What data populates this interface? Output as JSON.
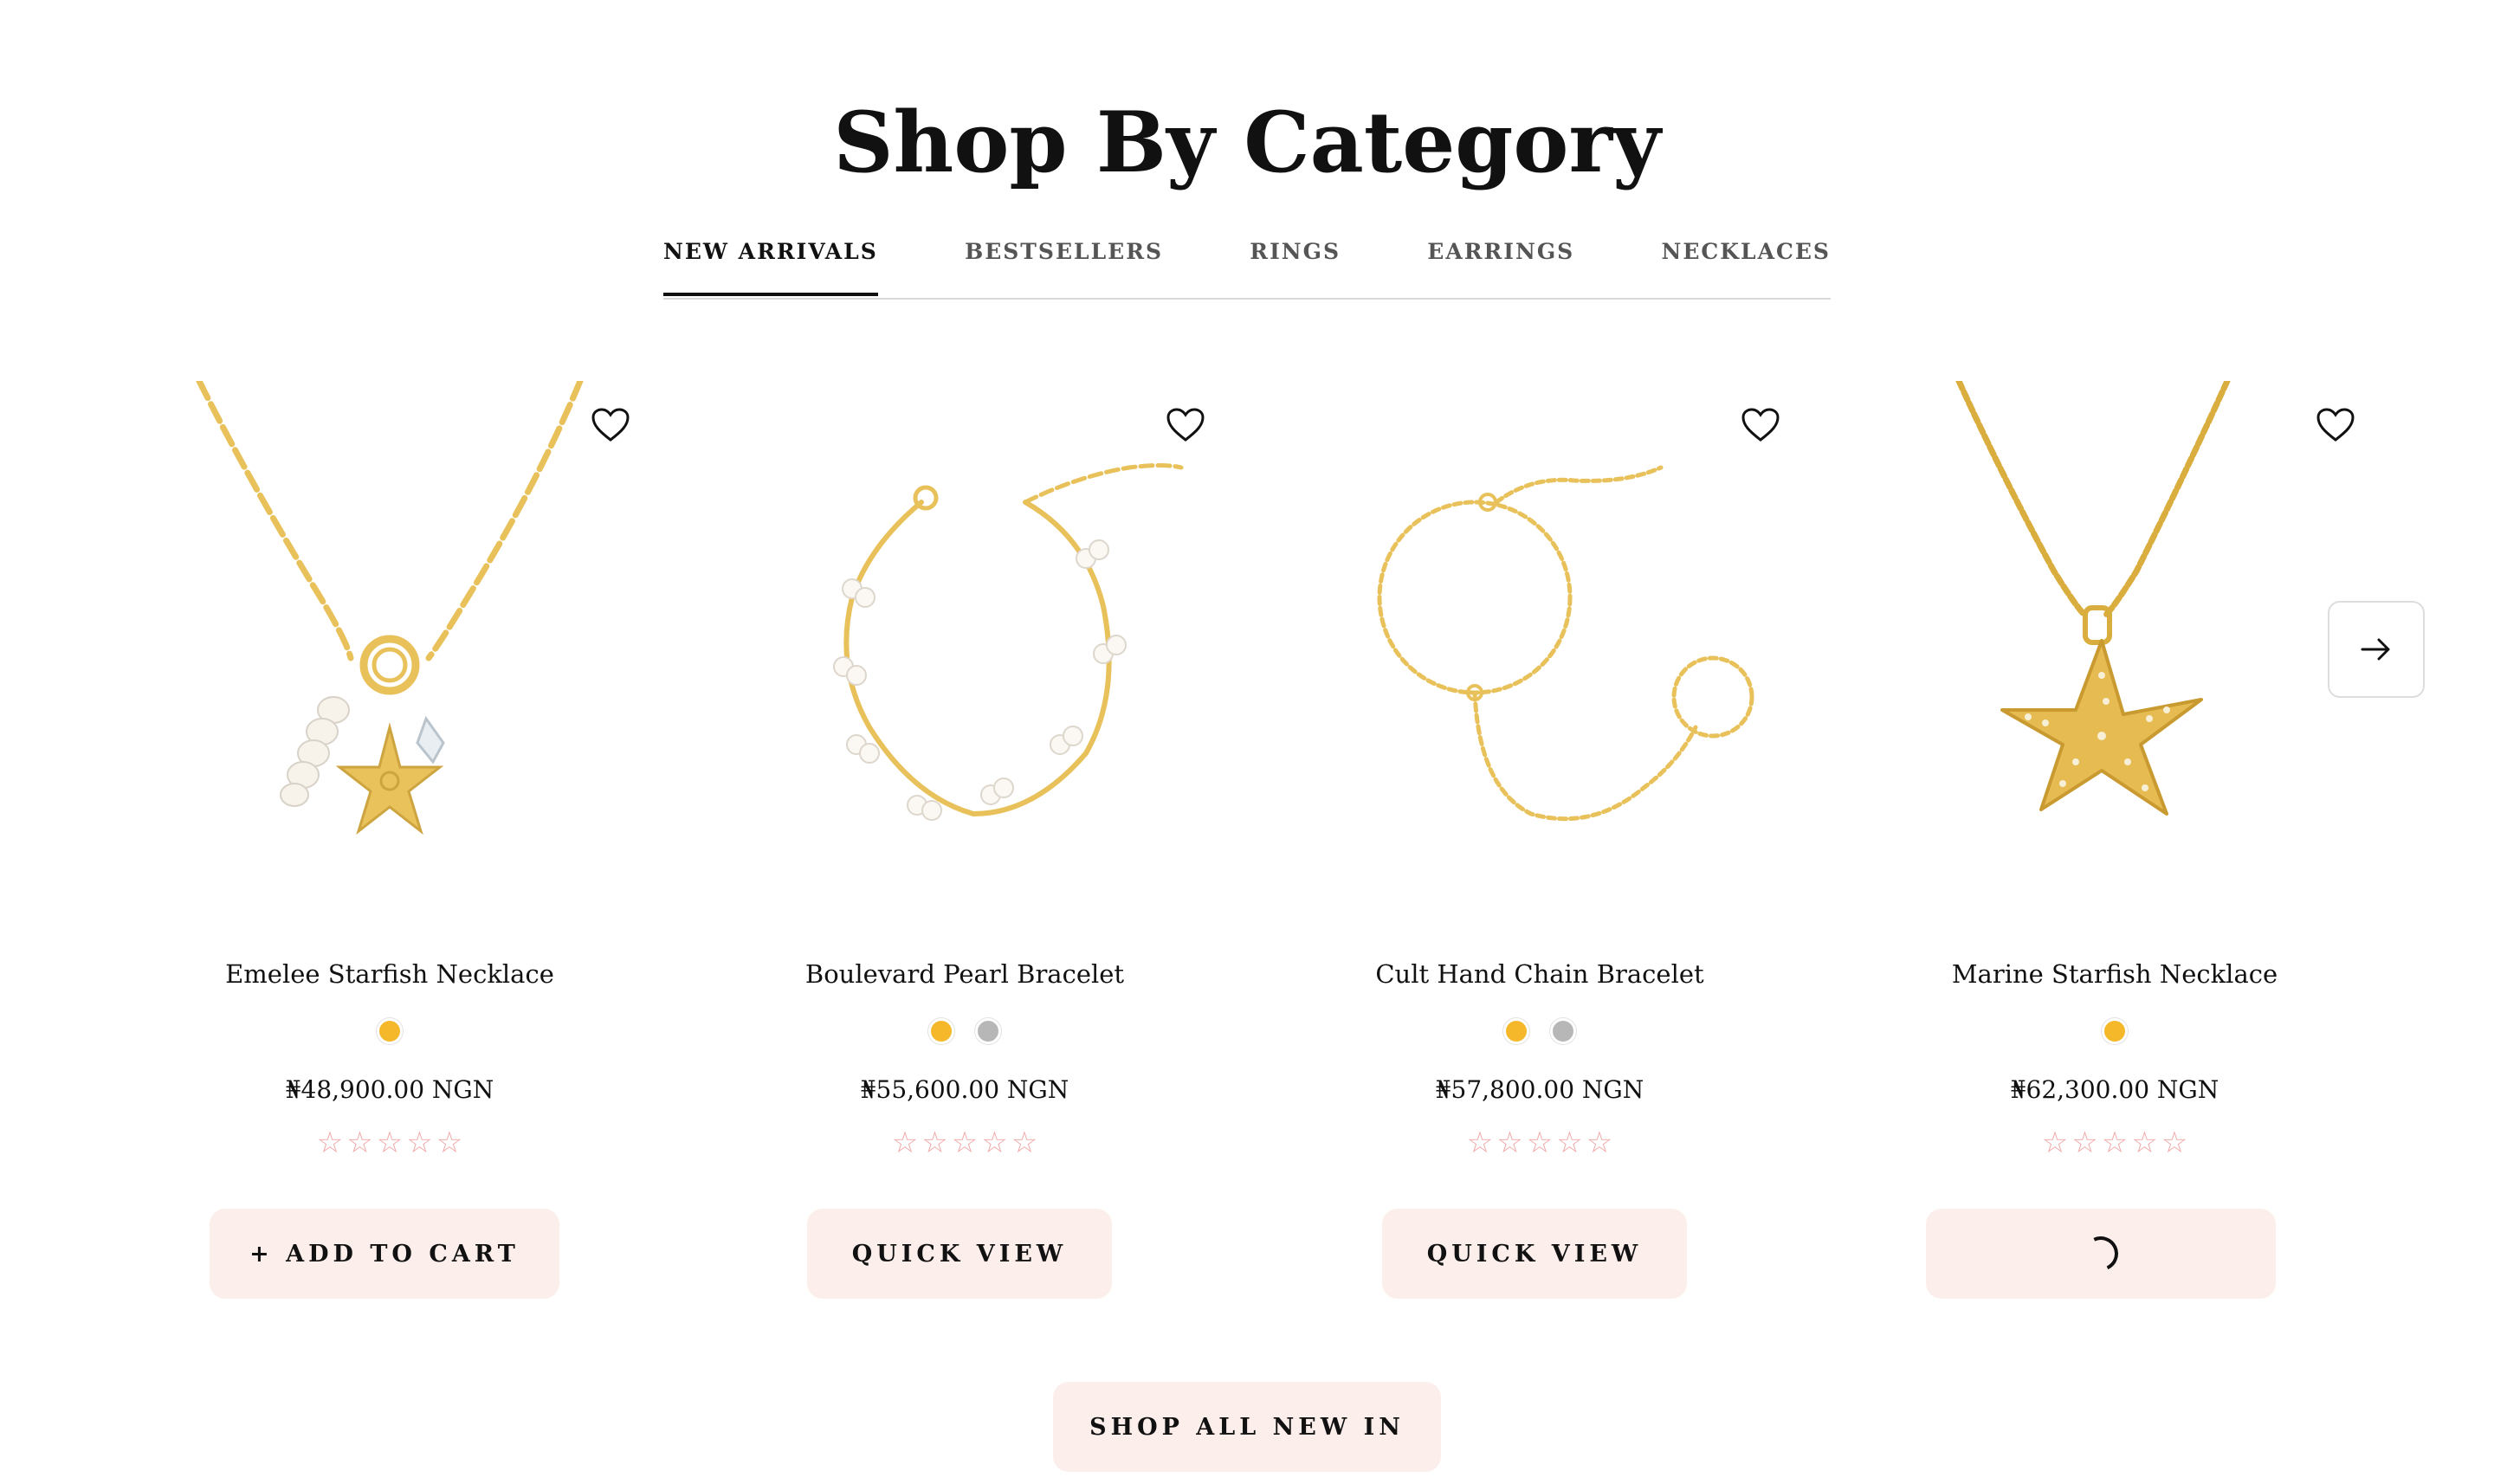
{
  "section": {
    "title": "Shop By Category"
  },
  "tabs": [
    {
      "label": "NEW ARRIVALS",
      "active": true
    },
    {
      "label": "BESTSELLERS",
      "active": false
    },
    {
      "label": "RINGS",
      "active": false
    },
    {
      "label": "EARRINGS",
      "active": false
    },
    {
      "label": "NECKLACES",
      "active": false
    }
  ],
  "colors": {
    "gold_swatch": "#f5b82a",
    "silver_swatch": "#b7b7b7",
    "button_bg": "#fbeeeb",
    "star_outline": "#f2a7a7",
    "jewelry_gold": "#e8c15a"
  },
  "products": [
    {
      "name": "Emelee Starfish Necklace",
      "price": "₦48,900.00 NGN",
      "rating": 0,
      "rating_max": 5,
      "swatches": [
        "gold"
      ],
      "button": "+ ADD TO CART",
      "image_icon": "starfish-charm-necklace-image"
    },
    {
      "name": "Boulevard Pearl Bracelet",
      "price": "₦55,600.00 NGN",
      "rating": 0,
      "rating_max": 5,
      "swatches": [
        "gold",
        "silver"
      ],
      "button": "QUICK VIEW",
      "image_icon": "pearl-bracelet-image"
    },
    {
      "name": "Cult Hand Chain Bracelet",
      "price": "₦57,800.00 NGN",
      "rating": 0,
      "rating_max": 5,
      "swatches": [
        "gold",
        "silver"
      ],
      "button": "QUICK VIEW",
      "image_icon": "hand-chain-bracelet-image"
    },
    {
      "name": "Marine Starfish Necklace",
      "price": "₦62,300.00 NGN",
      "rating": 0,
      "rating_max": 5,
      "swatches": [
        "gold"
      ],
      "button": "",
      "button_state": "loading",
      "image_icon": "starfish-pendant-necklace-image"
    }
  ],
  "icons": {
    "wishlist": "heart-icon",
    "carousel_next": "arrow-right-icon",
    "rating_star": "star-outline-icon",
    "loading": "spinner-icon"
  },
  "cta": {
    "shop_all": "SHOP ALL NEW IN"
  }
}
